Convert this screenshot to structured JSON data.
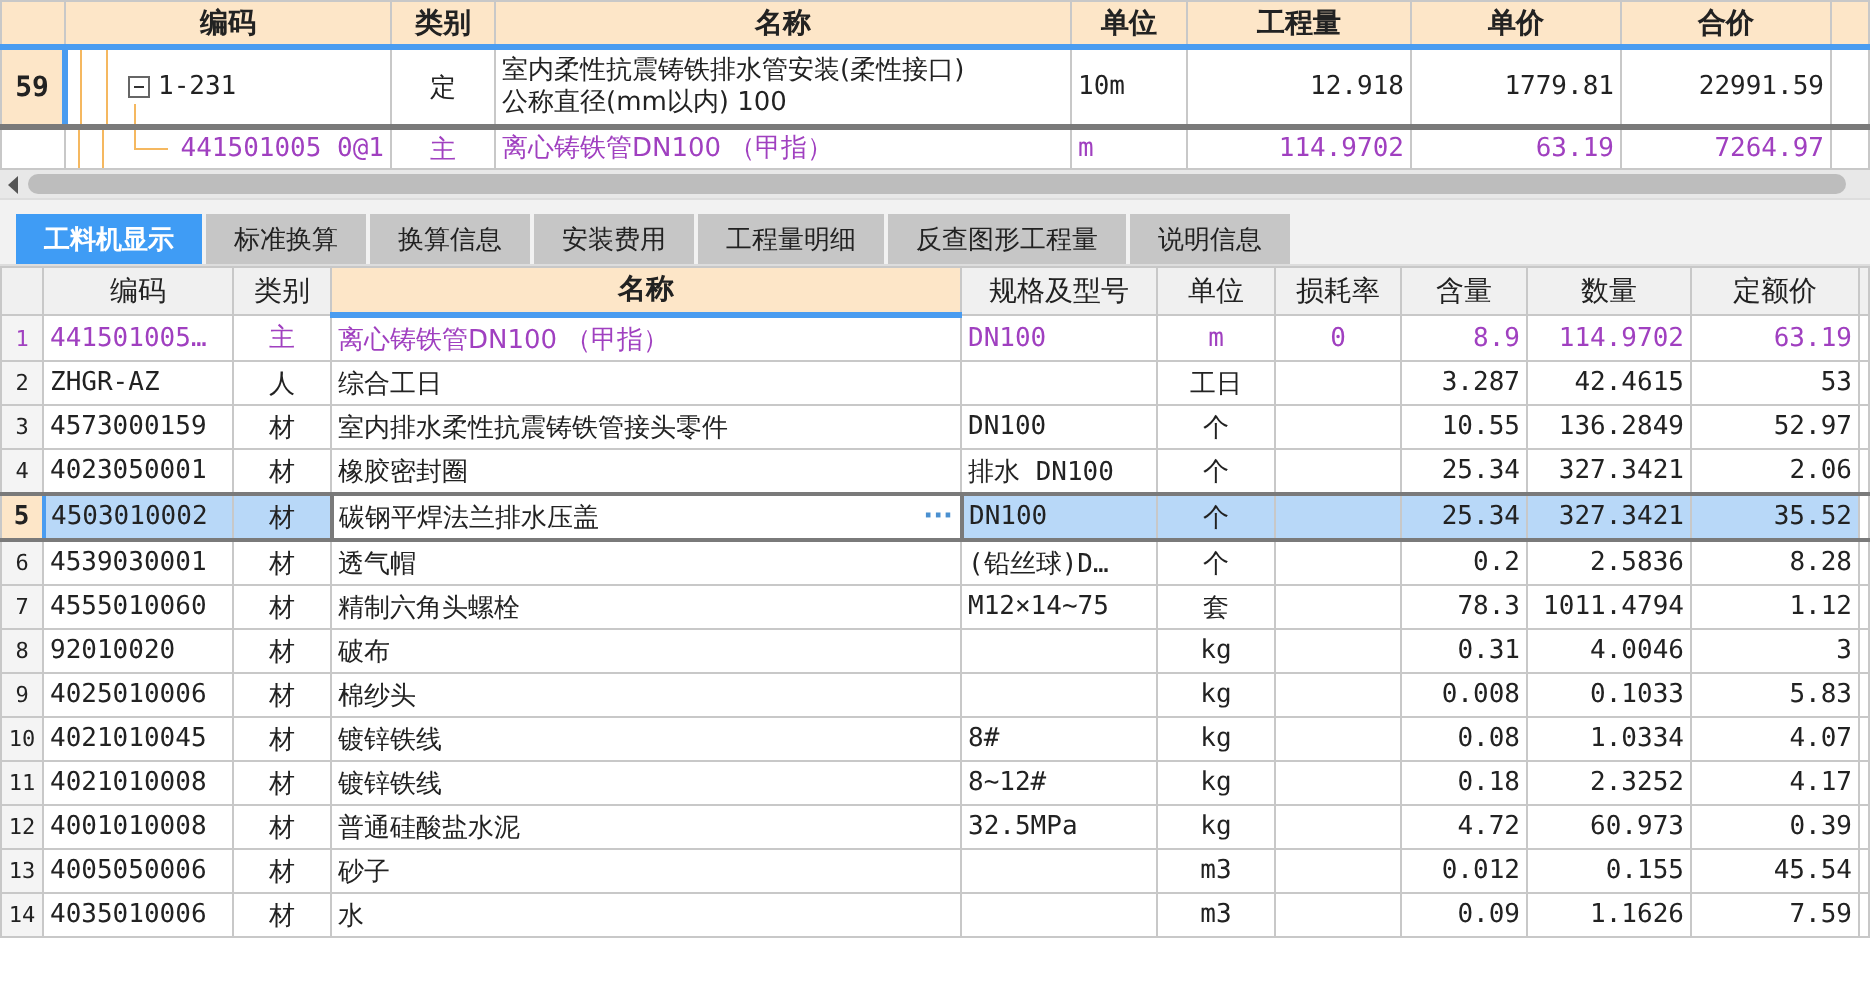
{
  "top_grid": {
    "columns": [
      "编码",
      "类别",
      "名称",
      "单位",
      "工程量",
      "单价",
      "合价"
    ],
    "rows": [
      {
        "row_number": "59",
        "kind": "item",
        "expanded": true,
        "selected": true,
        "cells": [
          "1-231",
          "定",
          [
            "室内柔性抗震铸铁排水管安装(柔性接口)",
            "公称直径(mm以内) 100"
          ],
          "10m",
          "12.918",
          "1779.81",
          "22991.59"
        ]
      },
      {
        "kind": "main",
        "selected": false,
        "cells": [
          "441501005 0@1",
          "主",
          [
            "离心铸铁管DN100 （甲指）"
          ],
          "m",
          "114.9702",
          "63.19",
          "7264.97"
        ]
      }
    ]
  },
  "tabs": [
    {
      "label": "工料机显示",
      "selected": true
    },
    {
      "label": "标准换算",
      "selected": false
    },
    {
      "label": "换算信息",
      "selected": false
    },
    {
      "label": "安装费用",
      "selected": false
    },
    {
      "label": "工程量明细",
      "selected": false
    },
    {
      "label": "反查图形工程量",
      "selected": false
    },
    {
      "label": "说明信息",
      "selected": false
    }
  ],
  "detail_grid": {
    "columns": [
      {
        "label": "编码",
        "selected": false
      },
      {
        "label": "类别",
        "selected": false
      },
      {
        "label": "名称",
        "selected": true
      },
      {
        "label": "规格及型号",
        "selected": false
      },
      {
        "label": "单位",
        "selected": false
      },
      {
        "label": "损耗率",
        "selected": false
      },
      {
        "label": "含量",
        "selected": false
      },
      {
        "label": "数量",
        "selected": false
      },
      {
        "label": "定额价",
        "selected": false
      }
    ],
    "rows": [
      {
        "row_number": "1",
        "kind": "main",
        "selected": false,
        "cells": [
          "441501005…",
          "主",
          "离心铸铁管DN100 （甲指）",
          "DN100",
          "m",
          "0",
          "8.9",
          "114.9702",
          "63.19"
        ]
      },
      {
        "row_number": "2",
        "kind": "normal",
        "selected": false,
        "cells": [
          "ZHGR-AZ",
          "人",
          "综合工日",
          "",
          "工日",
          "",
          "3.287",
          "42.4615",
          "53"
        ]
      },
      {
        "row_number": "3",
        "kind": "normal",
        "selected": false,
        "cells": [
          "4573000159",
          "材",
          "室内排水柔性抗震铸铁管接头零件",
          "DN100",
          "个",
          "",
          "10.55",
          "136.2849",
          "52.97"
        ]
      },
      {
        "row_number": "4",
        "kind": "normal",
        "selected": false,
        "cells": [
          "4023050001",
          "材",
          "橡胶密封圈",
          "排水 DN100",
          "个",
          "",
          "25.34",
          "327.3421",
          "2.06"
        ]
      },
      {
        "row_number": "5",
        "kind": "normal",
        "selected": true,
        "action": "···",
        "cells": [
          "4503010002",
          "材",
          "碳钢平焊法兰排水压盖",
          "DN100",
          "个",
          "",
          "25.34",
          "327.3421",
          "35.52"
        ]
      },
      {
        "row_number": "6",
        "kind": "normal",
        "selected": false,
        "cells": [
          "4539030001",
          "材",
          "透气帽",
          "(铅丝球)D…",
          "个",
          "",
          "0.2",
          "2.5836",
          "8.28"
        ]
      },
      {
        "row_number": "7",
        "kind": "normal",
        "selected": false,
        "cells": [
          "4555010060",
          "材",
          "精制六角头螺栓",
          "M12×14~75",
          "套",
          "",
          "78.3",
          "1011.4794",
          "1.12"
        ]
      },
      {
        "row_number": "8",
        "kind": "normal",
        "selected": false,
        "cells": [
          "92010020",
          "材",
          "破布",
          "",
          "kg",
          "",
          "0.31",
          "4.0046",
          "3"
        ]
      },
      {
        "row_number": "9",
        "kind": "normal",
        "selected": false,
        "cells": [
          "4025010006",
          "材",
          "棉纱头",
          "",
          "kg",
          "",
          "0.008",
          "0.1033",
          "5.83"
        ]
      },
      {
        "row_number": "10",
        "kind": "normal",
        "selected": false,
        "cells": [
          "4021010045",
          "材",
          "镀锌铁线",
          "8#",
          "kg",
          "",
          "0.08",
          "1.0334",
          "4.07"
        ]
      },
      {
        "row_number": "11",
        "kind": "normal",
        "selected": false,
        "cells": [
          "4021010008",
          "材",
          "镀锌铁线",
          "8~12#",
          "kg",
          "",
          "0.18",
          "2.3252",
          "4.17"
        ]
      },
      {
        "row_number": "12",
        "kind": "normal",
        "selected": false,
        "cells": [
          "4001010008",
          "材",
          "普通硅酸盐水泥",
          "32.5MPa",
          "kg",
          "",
          "4.72",
          "60.973",
          "0.39"
        ]
      },
      {
        "row_number": "13",
        "kind": "normal",
        "selected": false,
        "cells": [
          "4005050006",
          "材",
          "砂子",
          "",
          "m3",
          "",
          "0.012",
          "0.155",
          "45.54"
        ]
      },
      {
        "row_number": "14",
        "kind": "normal",
        "selected": false,
        "cells": [
          "4035010006",
          "材",
          "水",
          "",
          "m3",
          "",
          "0.09",
          "1.1626",
          "7.59"
        ]
      }
    ]
  }
}
